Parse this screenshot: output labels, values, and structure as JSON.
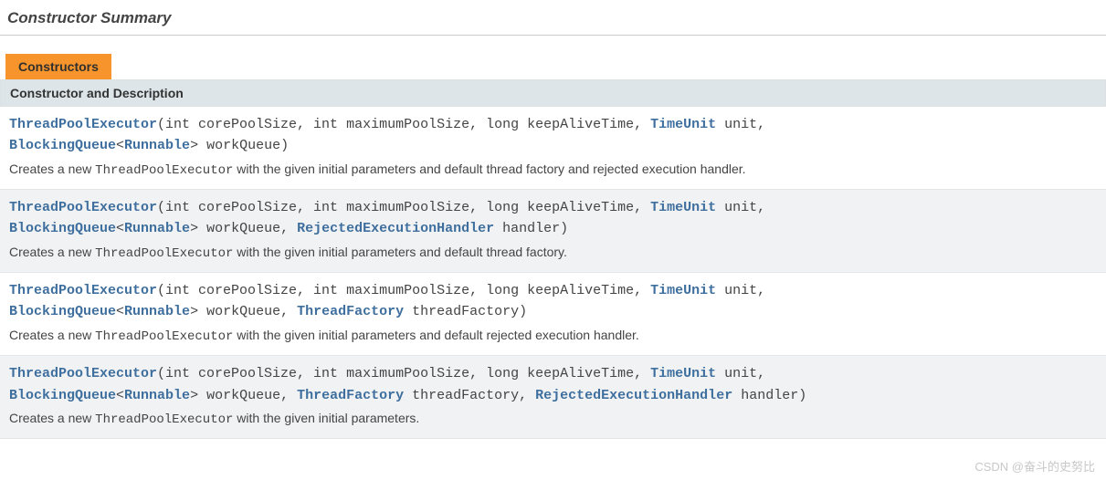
{
  "section_title": "Constructor Summary",
  "tab_label": "Constructors",
  "table_header": "Constructor and Description",
  "type_links": {
    "TimeUnit": "TimeUnit",
    "BlockingQueue": "BlockingQueue",
    "Runnable": "Runnable",
    "RejectedExecutionHandler": "RejectedExecutionHandler",
    "ThreadFactory": "ThreadFactory"
  },
  "constructors": [
    {
      "name": "ThreadPoolExecutor",
      "sig_part1": "(int corePoolSize, int maximumPoolSize, long keepAliveTime, ",
      "sig_part2": " unit, ",
      "sig_part3": "<",
      "sig_part4": "> workQueue)",
      "desc_prefix": "Creates a new ",
      "desc_class": "ThreadPoolExecutor",
      "desc_suffix": " with the given initial parameters and default thread factory and rejected execution handler."
    },
    {
      "name": "ThreadPoolExecutor",
      "sig_part1": "(int corePoolSize, int maximumPoolSize, long keepAliveTime, ",
      "sig_part2": " unit, ",
      "sig_part3": "<",
      "sig_part4": "> workQueue, ",
      "sig_part5": " handler)",
      "desc_prefix": "Creates a new ",
      "desc_class": "ThreadPoolExecutor",
      "desc_suffix": " with the given initial parameters and default thread factory."
    },
    {
      "name": "ThreadPoolExecutor",
      "sig_part1": "(int corePoolSize, int maximumPoolSize, long keepAliveTime, ",
      "sig_part2": " unit, ",
      "sig_part3": "<",
      "sig_part4": "> workQueue, ",
      "sig_part5": " threadFactory)",
      "desc_prefix": "Creates a new ",
      "desc_class": "ThreadPoolExecutor",
      "desc_suffix": " with the given initial parameters and default rejected execution handler."
    },
    {
      "name": "ThreadPoolExecutor",
      "sig_part1": "(int corePoolSize, int maximumPoolSize, long keepAliveTime, ",
      "sig_part2": " unit, ",
      "sig_part3": "<",
      "sig_part4": "> workQueue, ",
      "sig_part5": " threadFactory, ",
      "sig_part6": " handler)",
      "desc_prefix": "Creates a new ",
      "desc_class": "ThreadPoolExecutor",
      "desc_suffix": " with the given initial parameters."
    }
  ],
  "watermark": "CSDN @奋斗的史努比"
}
